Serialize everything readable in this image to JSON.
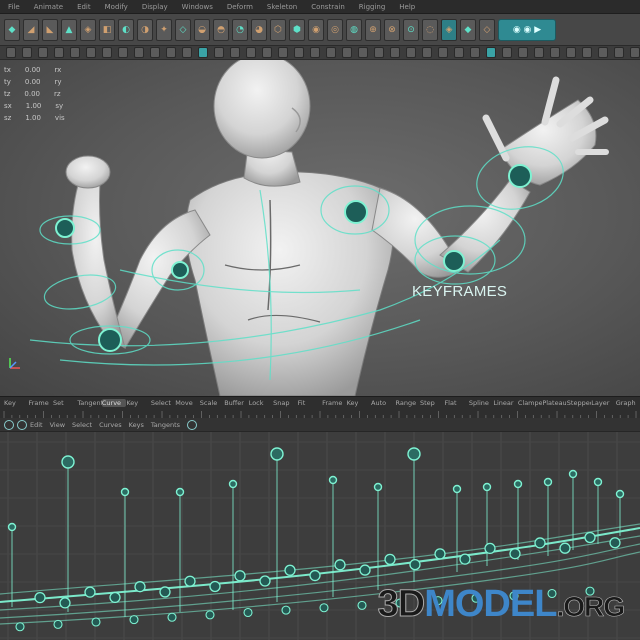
{
  "menubar": {
    "items": [
      "File",
      "Animate",
      "Edit",
      "Modify",
      "Display",
      "Windows",
      "Deform",
      "Skeleton",
      "Constrain",
      "Rigging",
      "Help"
    ]
  },
  "shelf": {
    "icon_count": 26,
    "active_index": 23
  },
  "viewport": {
    "channels": [
      [
        "tx",
        "0.00",
        "rx"
      ],
      [
        "ty",
        "0.00",
        "ry"
      ],
      [
        "tz",
        "0.00",
        "rz"
      ],
      [
        "sx",
        "1.00",
        "sy"
      ],
      [
        "sz",
        "1.00",
        "vis"
      ]
    ],
    "annotation": "KEYFRAMES"
  },
  "timeline": {
    "labels": [
      "Key",
      "Frame",
      "Set",
      "Tangent",
      "Curve",
      "Key",
      "Select",
      "Move",
      "Scale",
      "Buffer",
      "Lock",
      "Snap",
      "Fit",
      "Frame",
      "Key",
      "Auto",
      "Range",
      "Step",
      "Flat",
      "Spline",
      "Linear",
      "Clamped",
      "Plateau",
      "Stepped",
      "Layer",
      "Graph"
    ],
    "current_index": 4
  },
  "graph_editor": {
    "toolbar": [
      "Edit",
      "View",
      "Select",
      "Curves",
      "Keys",
      "Tangents"
    ]
  },
  "watermark": {
    "part1": "3D",
    "part2": "MODEL",
    "part3": ".ORG"
  },
  "colors": {
    "accent": "#5ee0c8",
    "curve": "#7ef2d2",
    "panel": "#3d3d3d"
  }
}
